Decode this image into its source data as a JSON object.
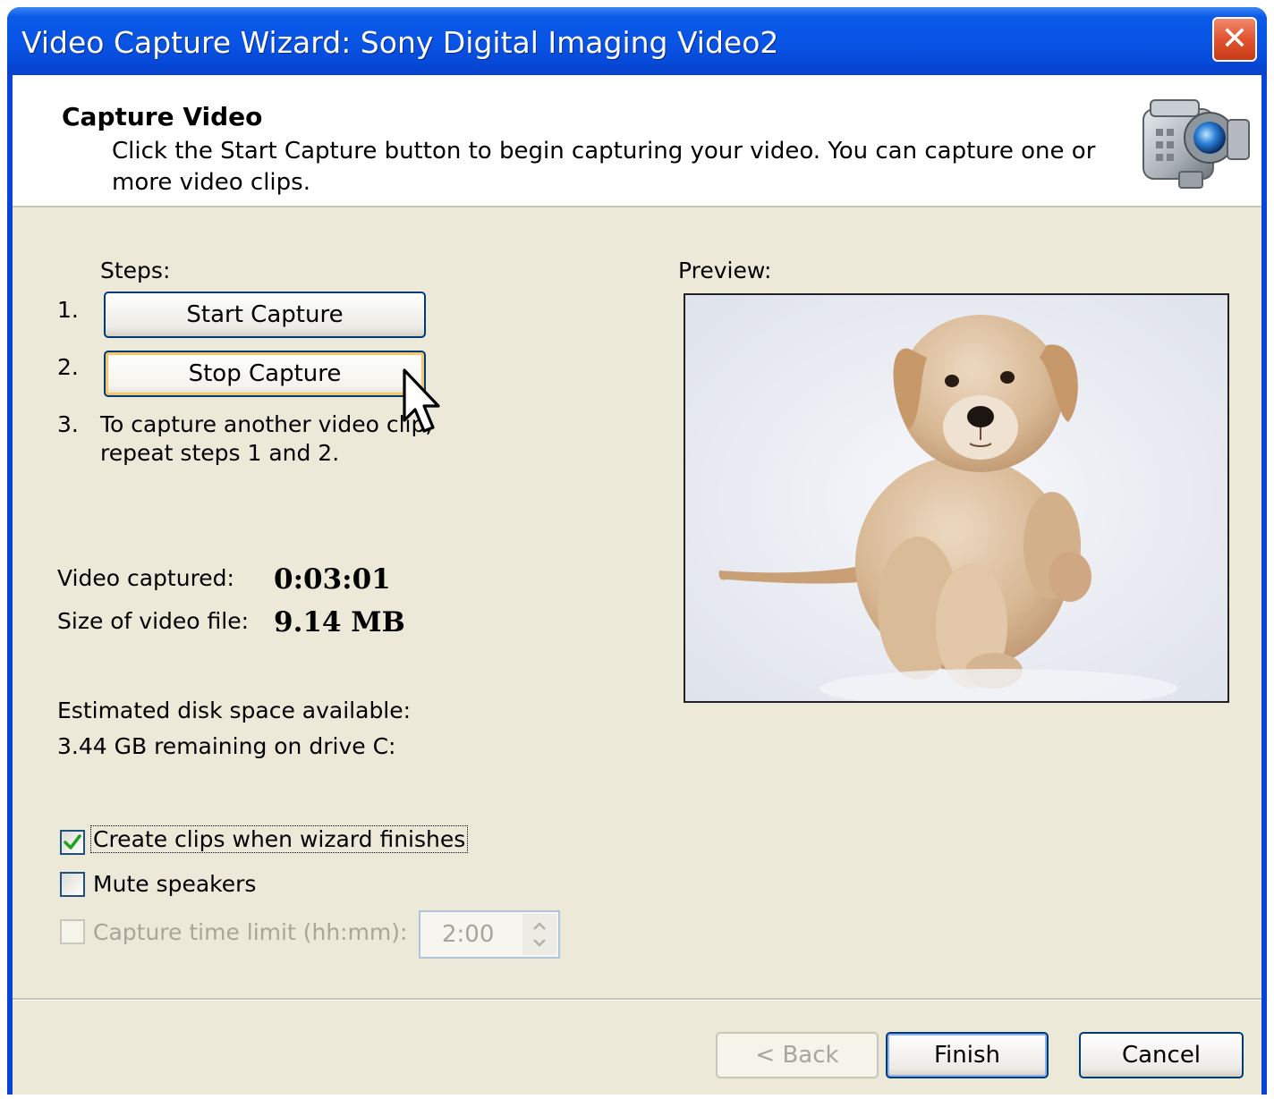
{
  "window": {
    "title": "Video Capture Wizard: Sony Digital Imaging Video2",
    "close_glyph": "✕"
  },
  "header": {
    "title": "Capture Video",
    "description": "Click the Start Capture button to begin capturing your video. You can capture one or more video clips.",
    "icon": "video-camera-icon"
  },
  "steps": {
    "label": "Steps:",
    "step1_num": "1.",
    "start_button": "Start Capture",
    "step2_num": "2.",
    "stop_button": "Stop Capture",
    "step3_num": "3.",
    "step3_text_line1": "To capture another video clip,",
    "step3_text_line2": "repeat steps 1 and 2."
  },
  "stats": {
    "video_captured_label": "Video captured:",
    "video_captured_value": "0:03:01",
    "file_size_label": "Size of video file:",
    "file_size_value": "9.14 MB",
    "disk_space_label": "Estimated disk space available:",
    "disk_space_value": "3.44 GB remaining on drive C:"
  },
  "options": {
    "create_clips_label": "Create clips when wizard finishes",
    "create_clips_checked": true,
    "mute_label": "Mute speakers",
    "mute_checked": false,
    "time_limit_label": "Capture time limit (hh:mm):",
    "time_limit_checked": false,
    "time_limit_value": "2:00"
  },
  "preview": {
    "label": "Preview:"
  },
  "footer": {
    "back_button": "< Back",
    "finish_button": "Finish",
    "cancel_button": "Cancel"
  }
}
